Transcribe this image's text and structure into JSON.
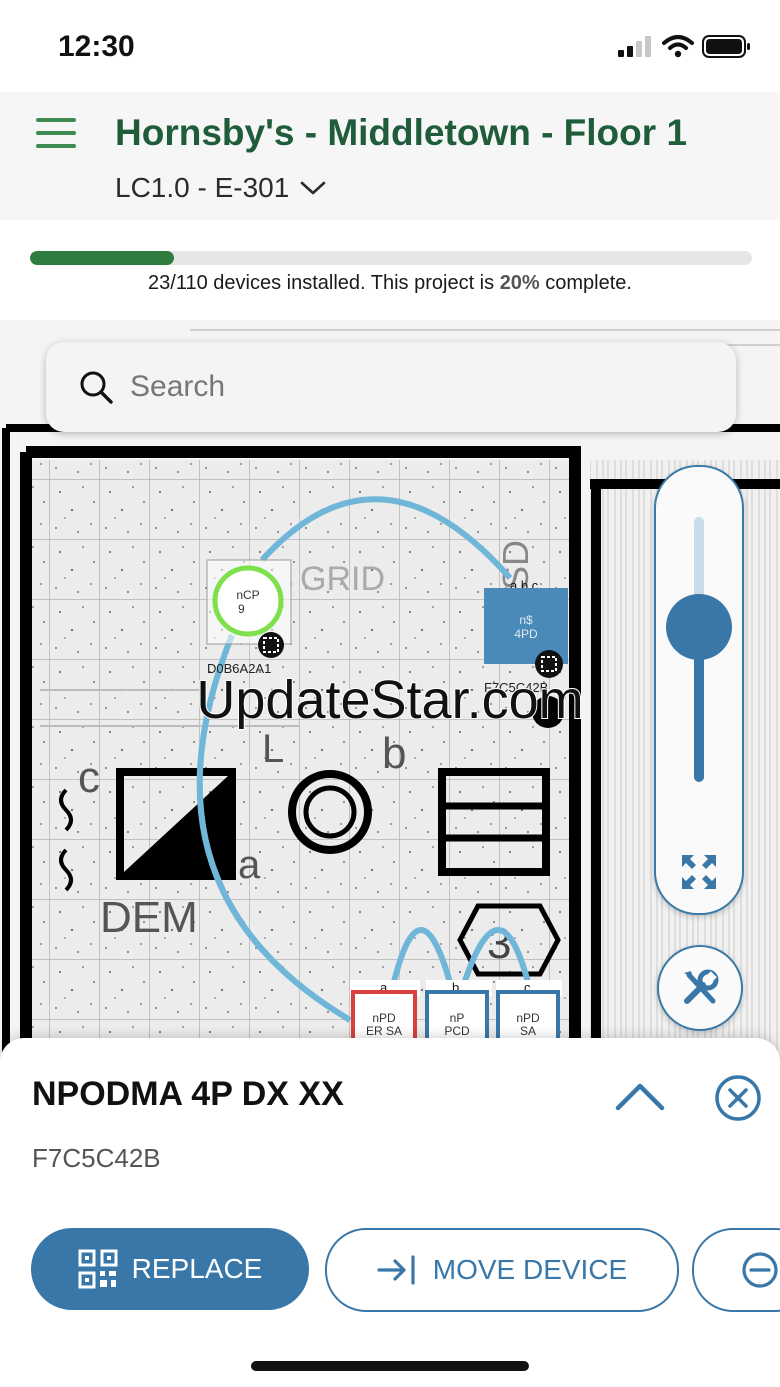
{
  "status_bar": {
    "time": "12:30"
  },
  "header": {
    "title": "Hornsby's - Middletown - Floor 1",
    "drawing": "LC1.0 - E-301"
  },
  "progress": {
    "installed": "23/110",
    "prefix": " devices installed. This project is ",
    "percent": "20%",
    "suffix": " complete.",
    "fraction": 0.2
  },
  "search": {
    "placeholder": "Search"
  },
  "plan": {
    "devices": [
      {
        "label1": "nCP",
        "label2": "9",
        "id": "D0B6A2A1"
      },
      {
        "label1": "n$",
        "label2": "4PD",
        "id": "F7C5C42B",
        "tag": "a,b,c"
      },
      {
        "label1": "nPD",
        "label2": "ER SA",
        "tag": "a"
      },
      {
        "label1": "nP",
        "label2": "PCD",
        "tag": "b"
      },
      {
        "label1": "nPD",
        "label2": "SA",
        "tag": "c"
      }
    ],
    "room_marks": [
      "c",
      "L",
      "b",
      "a",
      "DEM",
      "3",
      "SD",
      "GRID"
    ]
  },
  "watermark": "UpdateStar.com",
  "sheet": {
    "device_name": "NPODMA 4P DX XX",
    "device_id": "F7C5C42B",
    "replace_label": "REPLACE",
    "move_label": "MOVE DEVICE"
  },
  "colors": {
    "brand_green": "#1f5c3a",
    "progress_green": "#2e7d3f",
    "accent_blue": "#3977a8",
    "wire_blue": "#6fb6d8",
    "ring_green": "#7ee04a",
    "device_red": "#d64040"
  },
  "icons": [
    "signal-icon",
    "wifi-icon",
    "battery-icon",
    "menu-icon",
    "chevron-down-icon",
    "search-icon",
    "expand-icon",
    "tools-icon",
    "chevron-up-icon",
    "close-icon",
    "qr-icon",
    "move-icon",
    "minus-icon"
  ]
}
